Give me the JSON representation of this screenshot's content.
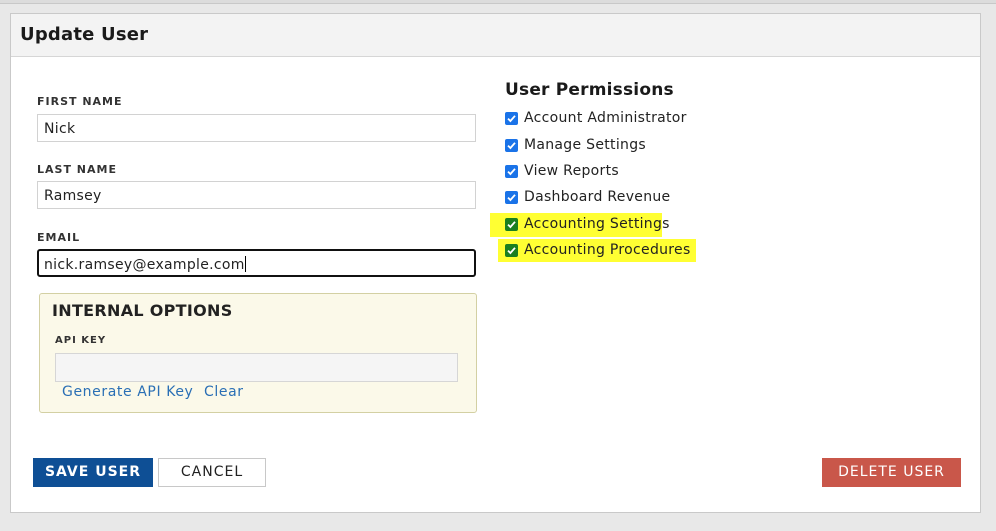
{
  "dialog": {
    "title": "Update User"
  },
  "form": {
    "first_name": {
      "label": "FIRST NAME",
      "value": "Nick"
    },
    "last_name": {
      "label": "LAST NAME",
      "value": "Ramsey"
    },
    "email": {
      "label": "EMAIL",
      "value": "nick.ramsey@example.com"
    }
  },
  "internal_options": {
    "title": "INTERNAL OPTIONS",
    "api_key": {
      "label": "API KEY",
      "value": ""
    },
    "generate_link": "Generate API Key",
    "clear_link": "Clear"
  },
  "permissions": {
    "title": "User Permissions",
    "items": [
      {
        "label": "Account Administrator",
        "checked": true,
        "highlighted": false
      },
      {
        "label": "Manage Settings",
        "checked": true,
        "highlighted": false
      },
      {
        "label": "View Reports",
        "checked": true,
        "highlighted": false
      },
      {
        "label": "Dashboard Revenue",
        "checked": true,
        "highlighted": false
      },
      {
        "label": "Accounting Settings",
        "checked": true,
        "highlighted": true
      },
      {
        "label": "Accounting Procedures",
        "checked": true,
        "highlighted": true
      }
    ]
  },
  "buttons": {
    "save": "SAVE USER",
    "cancel": "CANCEL",
    "delete": "DELETE USER"
  },
  "colors": {
    "primary": "#0e4f95",
    "danger": "#c9574a",
    "link": "#2a6fb5",
    "highlight": "#ffff33",
    "checkbox_blue": "#1a73e8",
    "checkbox_green": "#1a7f20"
  }
}
